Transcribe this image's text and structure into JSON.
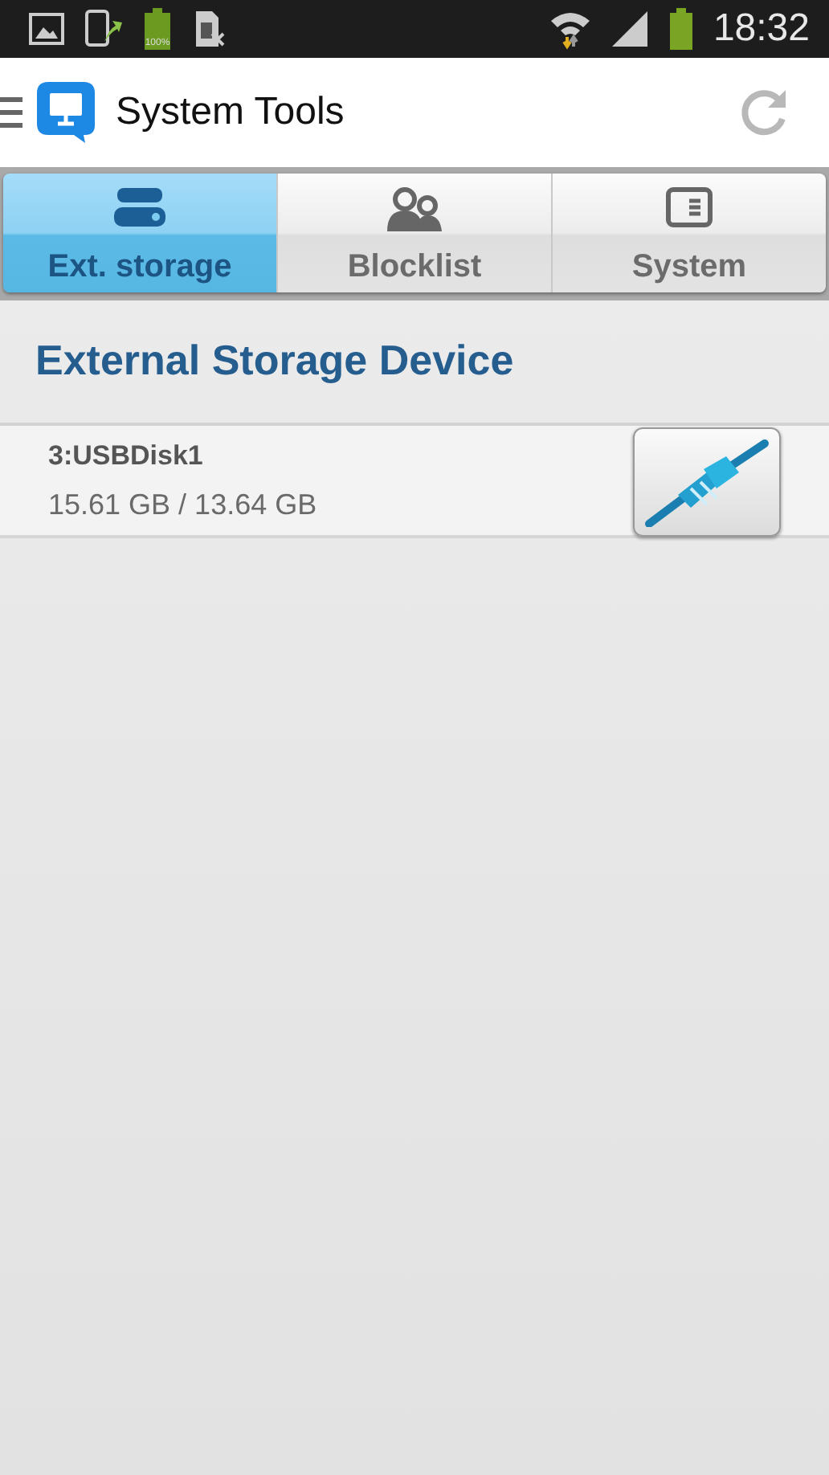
{
  "status_bar": {
    "battery_label": "100%",
    "time": "18:32"
  },
  "app_bar": {
    "title": "System Tools"
  },
  "tabs": [
    {
      "label": "Ext. storage",
      "selected": true
    },
    {
      "label": "Blocklist",
      "selected": false
    },
    {
      "label": "System",
      "selected": false
    }
  ],
  "section": {
    "title": "External Storage Device"
  },
  "devices": [
    {
      "name": "3:USBDisk1",
      "capacity": "15.61 GB / 13.64 GB"
    }
  ]
}
